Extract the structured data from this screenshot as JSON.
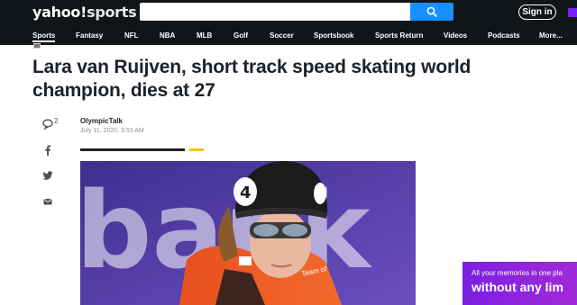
{
  "header": {
    "logo_text": "yahoo!",
    "logo_sub": "sports",
    "search_placeholder": "",
    "signin_label": "Sign in"
  },
  "nav": {
    "items": [
      "Sports",
      "Fantasy",
      "NFL",
      "NBA",
      "MLB",
      "Golf",
      "Soccer",
      "Sportsbook",
      "Sports Return",
      "Videos",
      "Podcasts",
      "More..."
    ]
  },
  "article": {
    "headline": "Lara van Ruijven, short track speed skating world champion, dies at 27",
    "author": "OlympicTalk",
    "date": "July 11, 2020, 3:53 AM",
    "comment_count": "2"
  },
  "hero_image": {
    "helmet_number": "4",
    "background_text": "bank",
    "jersey_text": "Team of"
  },
  "ad": {
    "line1": "All your memories in one pla",
    "line2": "without any lim"
  },
  "colors": {
    "header_bg": "#101518",
    "search_button": "#188fff",
    "accent_yellow": "#f7c400",
    "ad_purple": "#7c1fe0"
  },
  "icons": [
    "search-icon",
    "comment-icon",
    "facebook-icon",
    "twitter-icon",
    "mail-icon"
  ]
}
